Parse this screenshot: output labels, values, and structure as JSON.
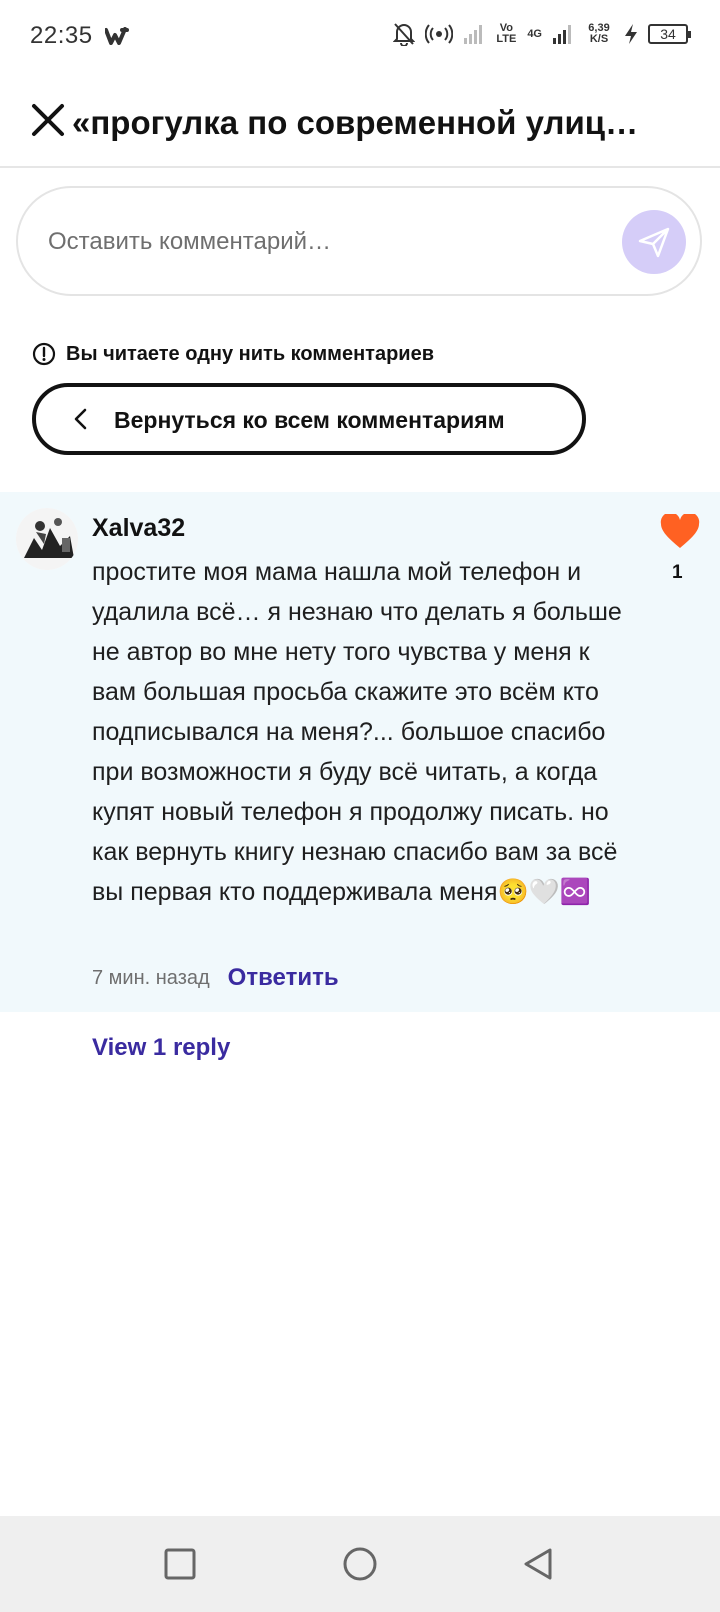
{
  "status_bar": {
    "time": "22:35",
    "app_icon": "wattpad-icon",
    "network_labels": {
      "volte": "Vo LTE",
      "g4": "4G",
      "speed": "6,39 K/S"
    },
    "battery": "34"
  },
  "header": {
    "close_icon": "close-icon",
    "title": "«прогулка по современной улиц…"
  },
  "composer": {
    "placeholder": "Оставить комментарий…",
    "send_icon": "send-icon",
    "accent": "#d5cdf8"
  },
  "thread_notice": {
    "text": "Вы читаете одну нить комментариев",
    "back_all_label": "Вернуться ко всем комментариям"
  },
  "comment": {
    "author": "Xalva32",
    "text": "простите моя мама нашла мой телефон и удалила всё… я незнаю что делать я больше не автор во мне нету того чувства у меня к вам большая просьба скажите это всём кто подписывался на меня?... большое спасибо при возможности я буду всё читать, а когда купят новый телефон я продолжу писать. но как вернуть книгу незнаю спасибо вам за всё вы первая кто поддерживала меня🥺🤍♾️",
    "time": "7 мин. назад",
    "reply_label": "Ответить",
    "like_count": "1",
    "like_color": "#ff6122",
    "background": "#f1f9fc"
  },
  "view_replies_label": "View 1 reply",
  "link_color": "#3a2ba0",
  "nav_bar": {
    "buttons": [
      "recent-apps-icon",
      "home-icon",
      "back-icon"
    ]
  }
}
